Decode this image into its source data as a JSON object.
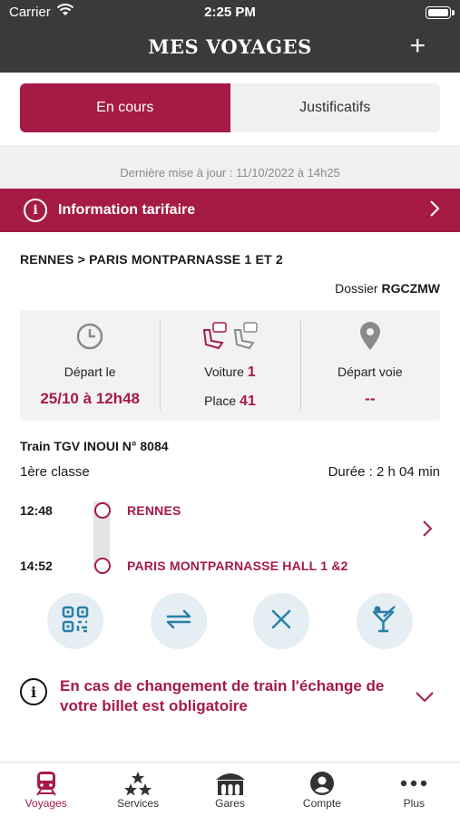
{
  "status_bar": {
    "carrier": "Carrier",
    "time": "2:25 PM"
  },
  "header": {
    "title": "MES VOYAGES",
    "add_label": "+"
  },
  "segments": [
    {
      "label": "En cours",
      "active": true
    },
    {
      "label": "Justificatifs",
      "active": false
    }
  ],
  "last_update": "Dernière mise à jour : 11/10/2022 à 14h25",
  "info_banner": {
    "icon": "info-icon",
    "label": "Information tarifaire"
  },
  "trip": {
    "route": "RENNES > PARIS MONTPARNASSE 1 ET 2",
    "dossier_label": "Dossier",
    "dossier_code": "RGCZMW"
  },
  "cards": {
    "departure_label": "Départ le",
    "departure_value": "25/10 à 12h48",
    "car_label": "Voiture",
    "car_value": "1",
    "seat_label": "Place",
    "seat_value": "41",
    "platform_label": "Départ voie",
    "platform_value": "--"
  },
  "train": {
    "name": "Train TGV INOUI N° 8084",
    "class": "1ère classe",
    "duration": "Durée : 2 h 04 min"
  },
  "stops": [
    {
      "time": "12:48",
      "station": "RENNES"
    },
    {
      "time": "14:52",
      "station": "PARIS MONTPARNASSE HALL 1 &2"
    }
  ],
  "actions": [
    "qr-code-icon",
    "exchange-arrows-icon",
    "cancel-x-icon",
    "bar-cocktail-icon"
  ],
  "notice": "En cas de changement de train l'échange de votre billet est obligatoire",
  "tabbar": [
    {
      "label": "Voyages",
      "icon": "train-icon",
      "active": true
    },
    {
      "label": "Services",
      "icon": "stars-icon",
      "active": false
    },
    {
      "label": "Gares",
      "icon": "station-icon",
      "active": false
    },
    {
      "label": "Compte",
      "icon": "account-icon",
      "active": false
    },
    {
      "label": "Plus",
      "icon": "more-dots-icon",
      "active": false
    }
  ],
  "colors": {
    "brand": "#a51b45",
    "header_bg": "#3a3a3a",
    "action_bg": "#e4eef3"
  }
}
